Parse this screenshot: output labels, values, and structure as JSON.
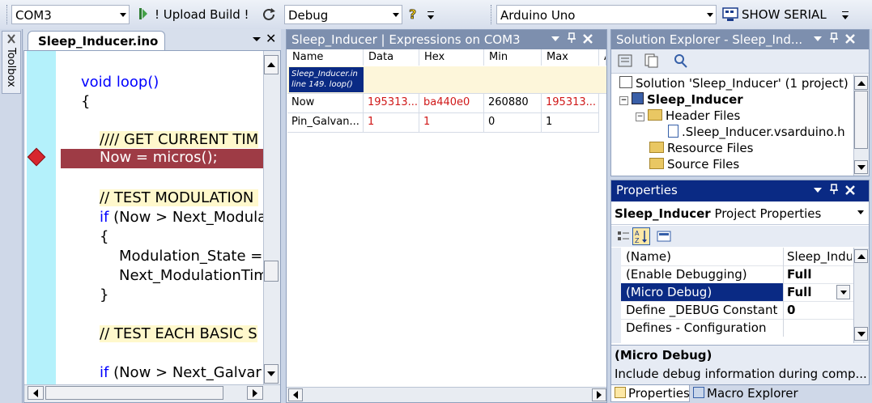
{
  "toolbar": {
    "port": "COM3",
    "upload_label": "! Upload Build !",
    "config": "Debug",
    "board": "Arduino Uno",
    "show_serial_label": "SHOW SERIAL"
  },
  "toolbox": {
    "label": "Toolbox"
  },
  "editor": {
    "tab_title": "Sleep_Inducer.ino",
    "close_glyph": "✕",
    "code_lines": {
      "l1": "void loop()",
      "l2": "{",
      "l3": "//// GET CURRENT TIM",
      "l4": "Now = micros();",
      "l5": "// TEST MODULATION ",
      "l6_kw": "if",
      "l6": " (Now > Next_Modula",
      "l7": "{",
      "l8": "Modulation_State =",
      "l9": "Next_ModulationTim",
      "l10": "}",
      "l11": "// TEST EACH BASIC S",
      "l12_kw": "if",
      "l12": " (Now > Next_Galvar"
    }
  },
  "expressions": {
    "title": "Sleep_Inducer | Expressions on COM3",
    "columns": [
      "Name",
      "Data",
      "Hex",
      "Min",
      "Max",
      "A"
    ],
    "context_line1": "Sleep_Inducer.in",
    "context_line2": "line 149. loop()",
    "rows": [
      {
        "name": "Now",
        "data": "195313...",
        "hex": "ba440e0",
        "min": "260880",
        "max": "195313..."
      },
      {
        "name": "Pin_Galvan...",
        "data": "1",
        "hex": "1",
        "min": "0",
        "max": "1"
      }
    ]
  },
  "solution_explorer": {
    "title": "Solution Explorer - Sleep_Ind...",
    "items": {
      "solution": "Solution 'Sleep_Inducer' (1 project)",
      "project": "Sleep_Inducer",
      "header_files": "Header Files",
      "header_file": ".Sleep_Inducer.vsarduino.h",
      "resource_files": "Resource Files",
      "source_files": "Source Files"
    }
  },
  "properties": {
    "title": "Properties",
    "object_bold": "Sleep_Inducer",
    "object_rest": " Project Properties",
    "rows": [
      {
        "name": "(Name)",
        "value": "Sleep_Indu"
      },
      {
        "name": "(Enable Debugging)",
        "value": "Full"
      },
      {
        "name": "(Micro Debug)",
        "value": "Full"
      },
      {
        "name": "Define _DEBUG Constant",
        "value": "0"
      },
      {
        "name": "Defines - Configuration",
        "value": ""
      }
    ],
    "desc_title": "(Micro Debug)",
    "desc_text": "Include debug information during comp...",
    "tabs": [
      "Properties",
      "Macro Explorer"
    ]
  },
  "colors": {
    "active_title": "#0a2a84",
    "inactive_title": "#7d8fae",
    "breakpoint_line": "#9e3b45",
    "value_changed": "#d01818"
  }
}
